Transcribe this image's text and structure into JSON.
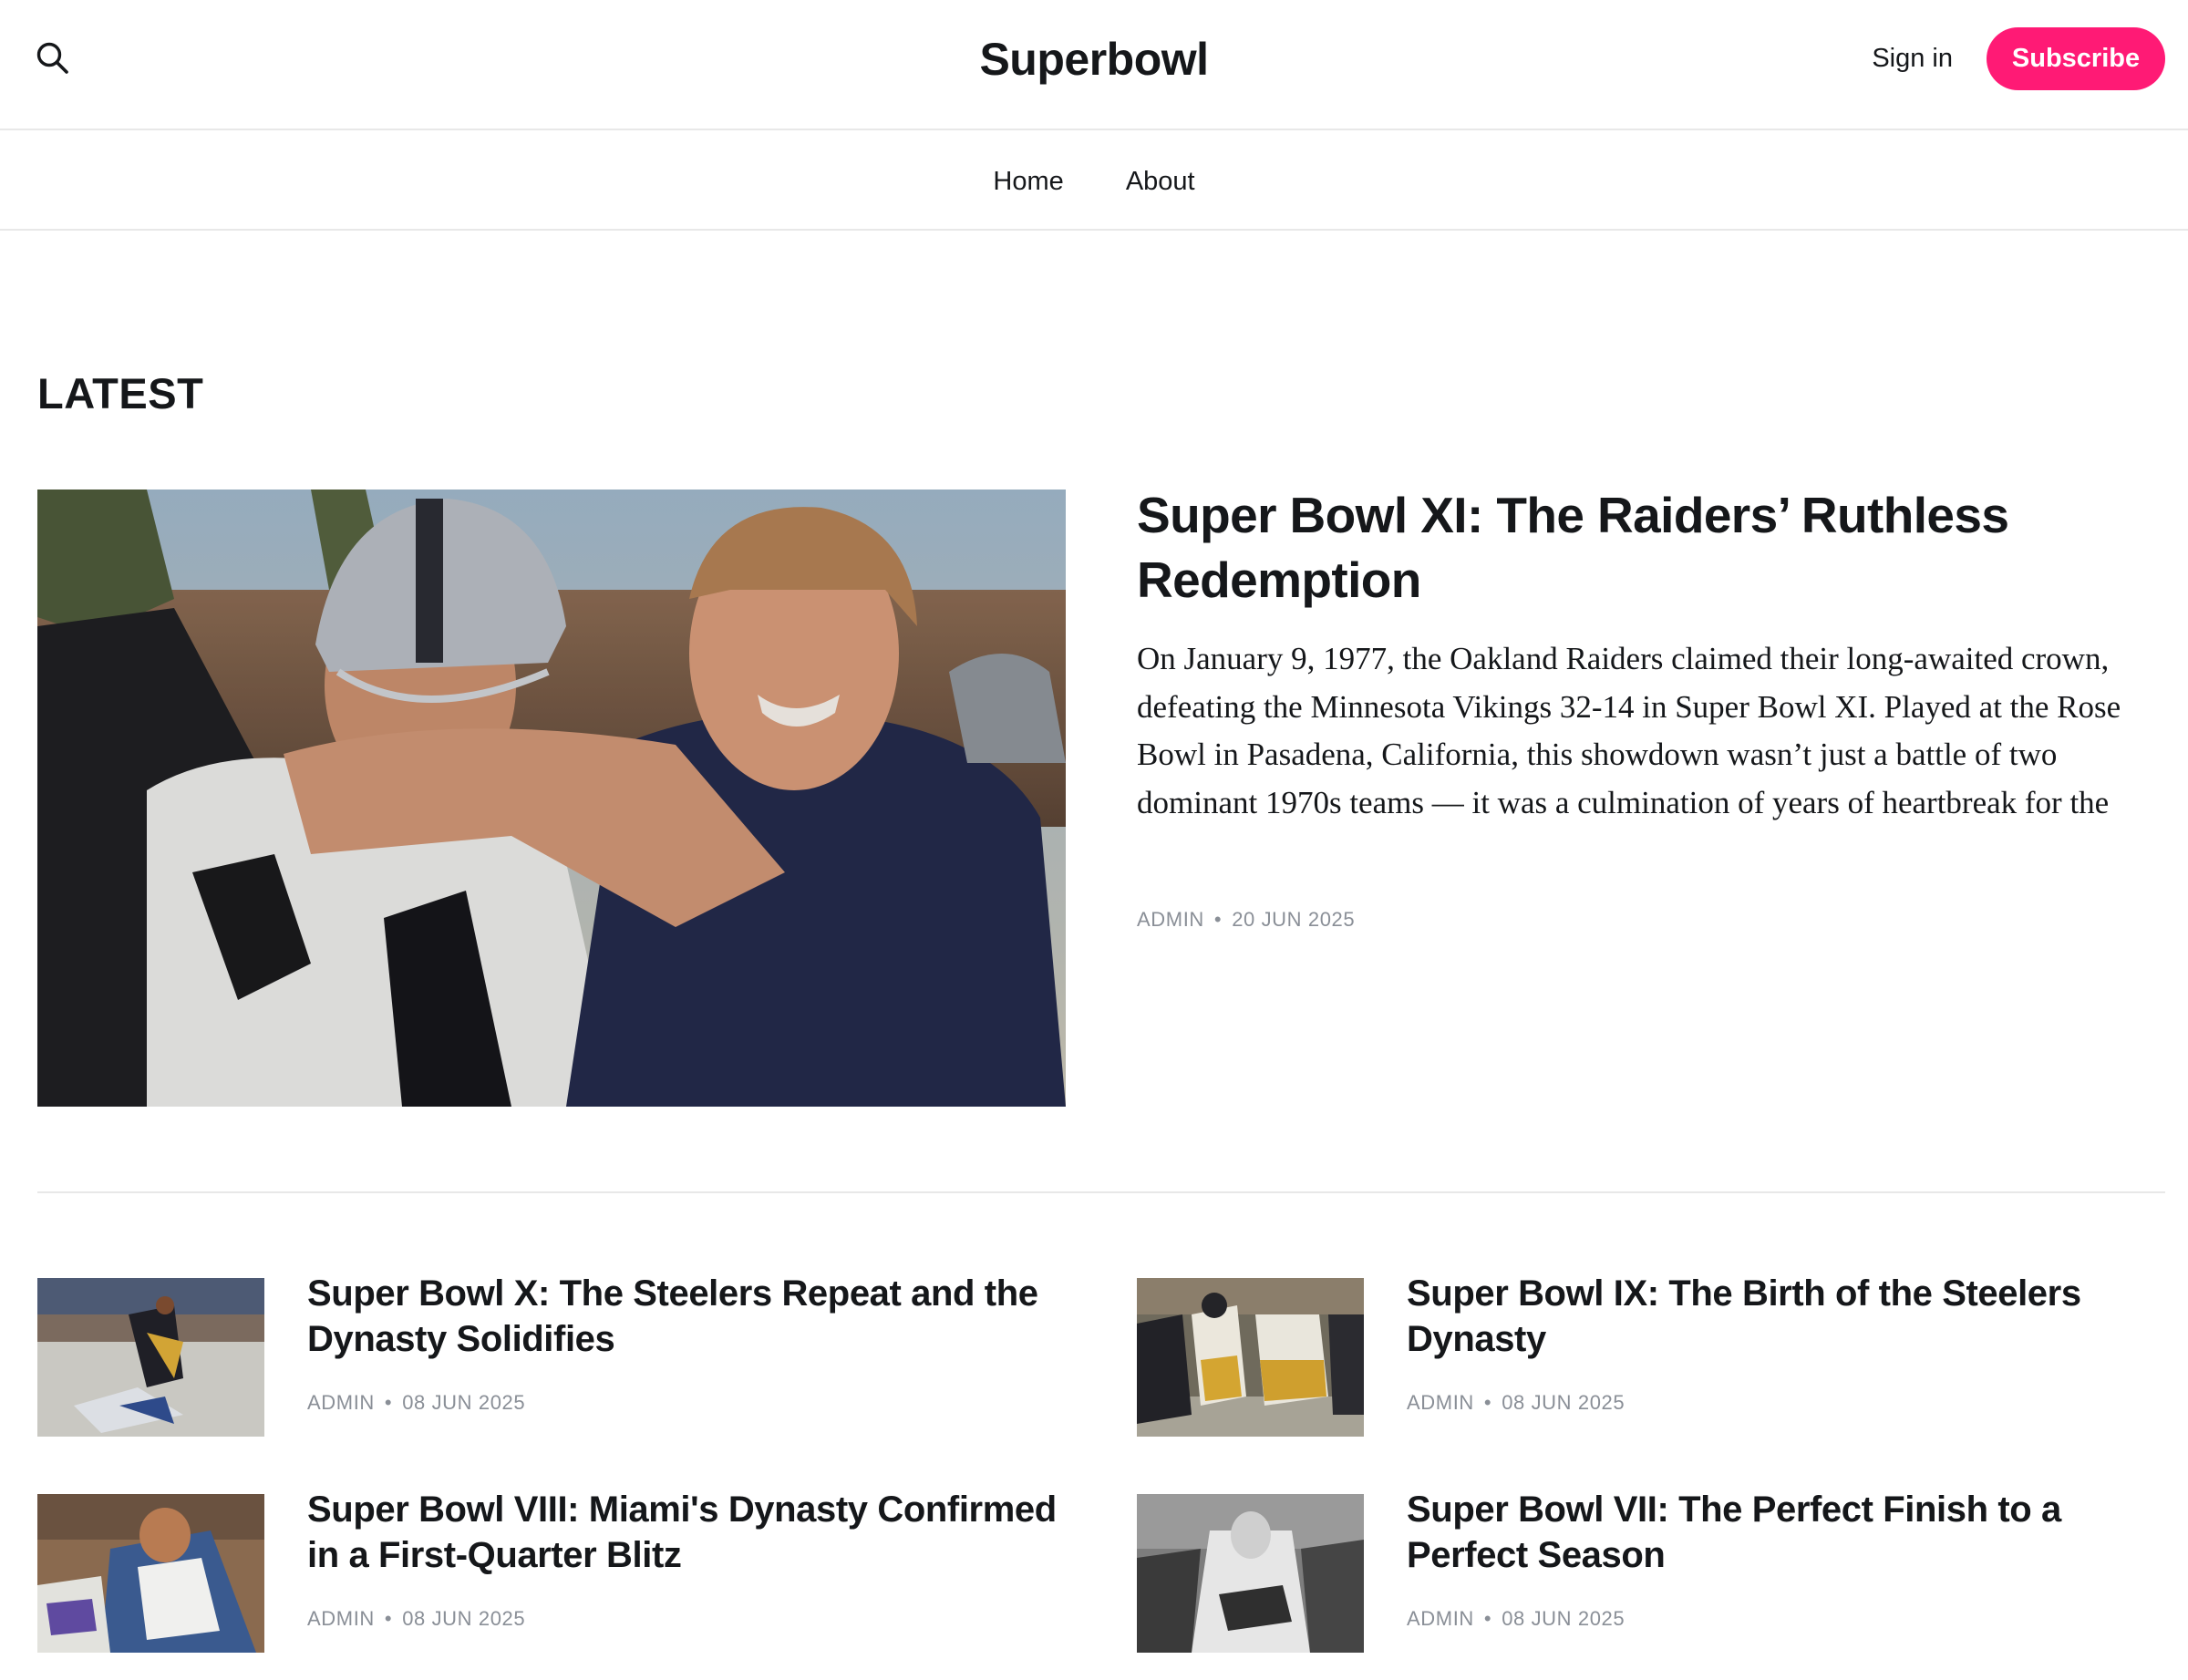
{
  "header": {
    "brand": "Superbowl",
    "signin_label": "Sign in",
    "subscribe_label": "Subscribe",
    "accent_color": "#ff1a75",
    "search_icon": "search-icon"
  },
  "nav": {
    "items": [
      {
        "label": "Home"
      },
      {
        "label": "About"
      }
    ]
  },
  "latest": {
    "section_title": "LATEST",
    "featured": {
      "title": "Super Bowl XI: The Raiders’ Ruthless Redemption",
      "excerpt": "On January 9, 1977, the Oakland Raiders claimed their long-awaited crown, defeating the Minnesota Vikings 32-14 in Super Bowl XI. Played at the Rose Bowl in Pasadena, California, this showdown wasn’t just a battle of two dominant 1970s teams — it was a culmination of years of heartbreak for the",
      "author": "ADMIN",
      "date": "20 JUN 2025"
    },
    "posts": [
      {
        "title": "Super Bowl X: The Steelers Repeat and the Dynasty Solidifies",
        "author": "ADMIN",
        "date": "08 JUN 2025"
      },
      {
        "title": "Super Bowl IX: The Birth of the Steelers Dynasty",
        "author": "ADMIN",
        "date": "08 JUN 2025"
      },
      {
        "title": "Super Bowl VIII: Miami's Dynasty Confirmed in a First-Quarter Blitz",
        "author": "ADMIN",
        "date": "08 JUN 2025"
      },
      {
        "title": "Super Bowl VII: The Perfect Finish to a Perfect Season",
        "author": "ADMIN",
        "date": "08 JUN 2025"
      }
    ]
  }
}
